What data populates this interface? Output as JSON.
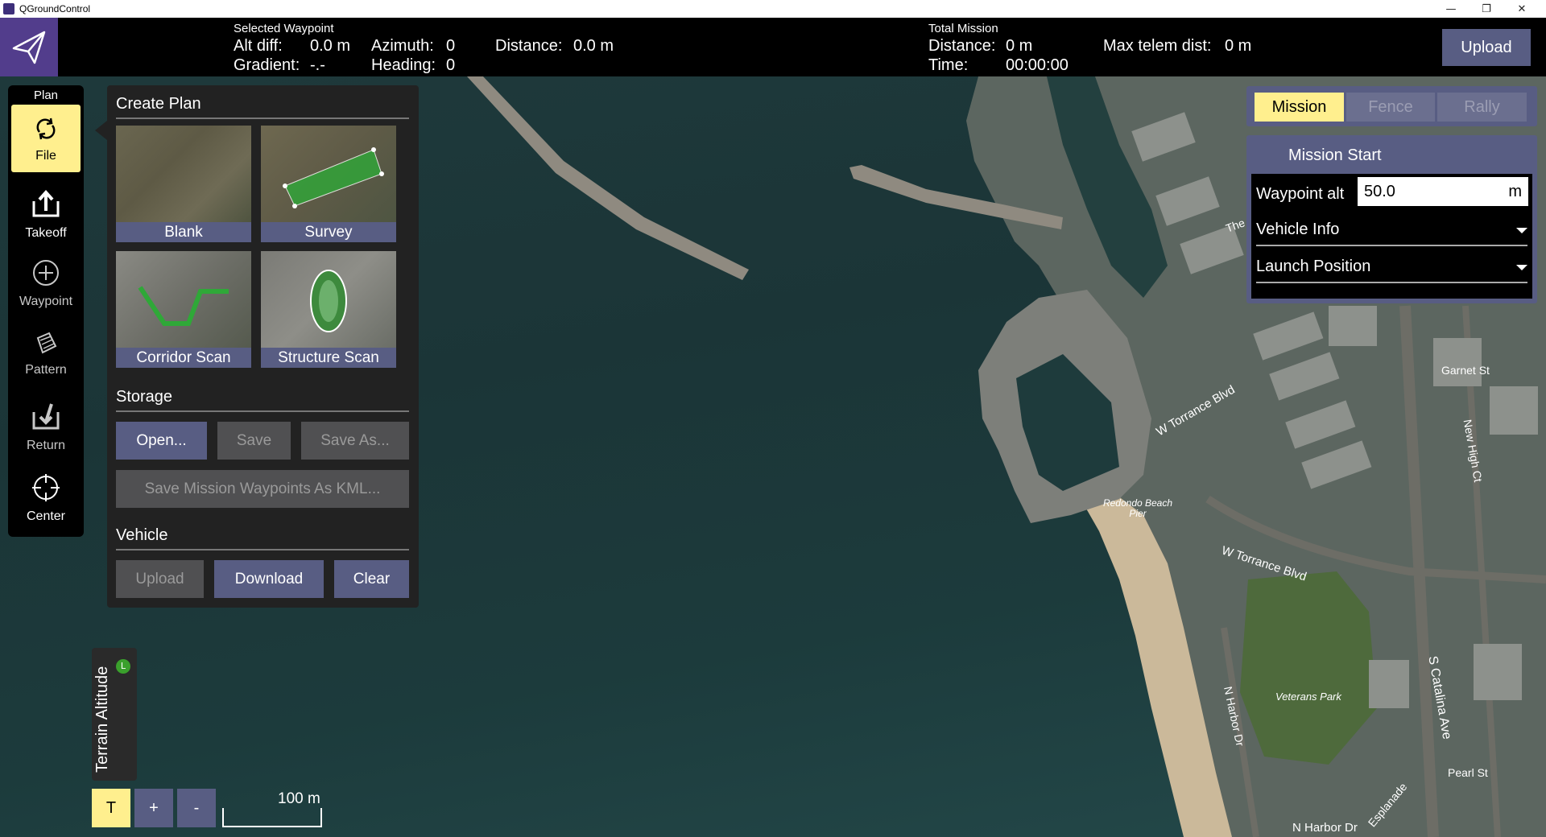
{
  "window": {
    "title": "QGroundControl",
    "controls": [
      "—",
      "❐",
      "✕"
    ]
  },
  "toolbar": {
    "selected_waypoint_label": "Selected Waypoint",
    "alt_diff_label": "Alt diff:",
    "alt_diff_value": "0.0 m",
    "gradient_label": "Gradient:",
    "gradient_value": "-.-",
    "azimuth_label": "Azimuth:",
    "azimuth_value": "0",
    "heading_label": "Heading:",
    "heading_value": "0",
    "distance_label": "Distance:",
    "distance_value": "0.0 m",
    "total_mission_label": "Total Mission",
    "total_distance_label": "Distance:",
    "total_distance_value": "0 m",
    "time_label": "Time:",
    "time_value": "00:00:00",
    "max_telem_label": "Max telem dist:",
    "max_telem_value": "0 m",
    "upload_label": "Upload"
  },
  "toolstrip": {
    "header": "Plan",
    "items": [
      {
        "label": "File",
        "icon": "sync-icon",
        "active": true
      },
      {
        "label": "Takeoff",
        "icon": "takeoff-icon"
      },
      {
        "label": "Waypoint",
        "icon": "waypoint-icon",
        "disabled": true
      },
      {
        "label": "Pattern",
        "icon": "pattern-icon",
        "disabled": true
      },
      {
        "label": "Return",
        "icon": "return-icon",
        "disabled": true
      },
      {
        "label": "Center",
        "icon": "center-icon"
      }
    ]
  },
  "create_plan": {
    "heading": "Create Plan",
    "templates": [
      "Blank",
      "Survey",
      "Corridor Scan",
      "Structure Scan"
    ],
    "storage_heading": "Storage",
    "open_label": "Open...",
    "save_label": "Save",
    "save_as_label": "Save As...",
    "save_kml_label": "Save Mission Waypoints As KML...",
    "vehicle_heading": "Vehicle",
    "upload_label": "Upload",
    "download_label": "Download",
    "clear_label": "Clear"
  },
  "mission_panel": {
    "tabs": [
      "Mission",
      "Fence",
      "Rally"
    ],
    "active_tab": "Mission",
    "mission_start": "Mission Start",
    "waypoint_alt_label": "Waypoint alt",
    "waypoint_alt_value": "50.0",
    "waypoint_alt_unit": "m",
    "vehicle_info_label": "Vehicle Info",
    "launch_position_label": "Launch Position"
  },
  "terrain": {
    "label": "Terrain Altitude",
    "badge": "L"
  },
  "map_controls": {
    "terrain_toggle": "T",
    "zoom_in": "+",
    "zoom_out": "-",
    "scale_label": "100 m"
  },
  "map_labels": {
    "garnet_st": "Garnet St",
    "w_torrance_blvd": "W Torrance Blvd",
    "w_torrance_blvd_2": "W Torrance Blvd",
    "redondo_pier": "Redondo Beach Pier",
    "veterans_park": "Veterans Park",
    "n_harbor_dr": "N Harbor Dr",
    "n_harbor_dr_2": "N Harbor Dr",
    "s_catalina_ave": "S Catalina Ave",
    "pearl_st": "Pearl St",
    "esplanade": "Esplanade",
    "new_high_ct": "New High Ct",
    "the": "The"
  },
  "colors": {
    "accent_yellow": "#ffef8e",
    "button_blue": "#585d83",
    "brand_purple": "#523d8c"
  }
}
